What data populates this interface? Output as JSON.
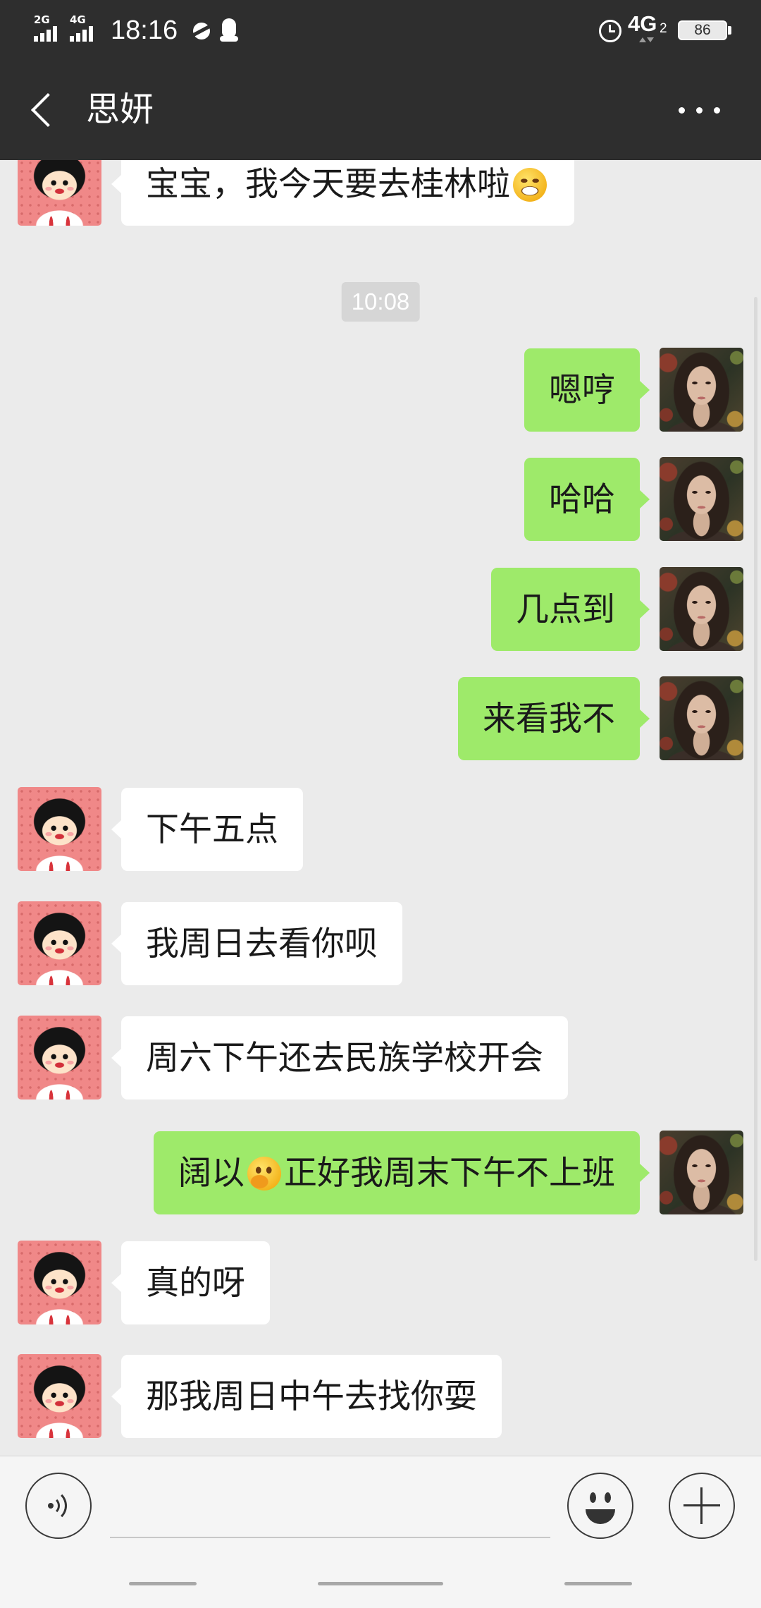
{
  "status_bar": {
    "sim1_label": "2G",
    "sim2_label": "4G",
    "time": "18:16",
    "network_type": "4G",
    "network_slot": "2",
    "battery_level": "86",
    "icons": [
      "signal-bars-icon",
      "planet-icon",
      "qq-penguin-icon",
      "alarm-clock-icon",
      "data-activity-icon",
      "battery-icon"
    ]
  },
  "header": {
    "title": "思妍",
    "back_icon": "chevron-left-icon",
    "more_icon": "more-dots-icon"
  },
  "chat": {
    "timestamp": "10:08",
    "messages": [
      {
        "text": "宝宝，我今天要去桂林啦",
        "emoji": "grinning-face-emoji-icon"
      },
      {
        "text": "嗯哼"
      },
      {
        "text": "哈哈"
      },
      {
        "text": "几点到"
      },
      {
        "text": "来看我不"
      },
      {
        "text": "下午五点"
      },
      {
        "text": "我周日去看你呗"
      },
      {
        "text": "周六下午还去民族学校开会"
      },
      {
        "text": "阔以",
        "emoji": "face-with-hand-over-mouth-emoji-icon",
        "text_after": "正好我周末下午不上班"
      },
      {
        "text": "真的呀"
      },
      {
        "text": "那我周日中午去找你耍"
      }
    ]
  },
  "input_bar": {
    "input_value": "",
    "voice_icon": "voice-input-icon",
    "emoji_icon": "emoji-icon",
    "plus_icon": "plus-icon"
  },
  "colors": {
    "header_bg": "#2e2e2e",
    "chat_bg": "#ebebeb",
    "sent_bubble": "#9eea6a",
    "received_bubble": "#ffffff",
    "timestamp_bg": "#d6d6d6",
    "input_bar_bg": "#f5f5f5"
  }
}
